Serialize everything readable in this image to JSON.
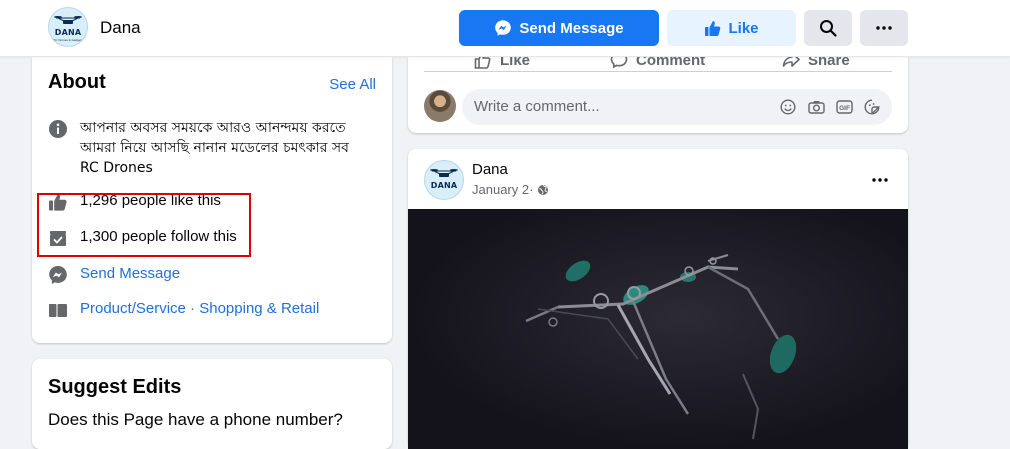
{
  "header": {
    "logo_text": "DANA",
    "logo_subtext": "RC Drones & Gadgets",
    "page_name": "Dana",
    "send_message_label": "Send Message",
    "like_label": "Like",
    "search_icon": "search-icon",
    "more_icon": "more-icon"
  },
  "about": {
    "title": "About",
    "see_all": "See All",
    "description": "আপনার অবসর সময়কে আরও আনন্দময় করতে আমরা নিয়ে আসছি নানান মডেলের চমৎকার সব RC Drones",
    "likes": "1,296 people like this",
    "follows": "1,300 people follow this",
    "send_message": "Send Message",
    "category_1": "Product/Service",
    "category_sep": " · ",
    "category_2": "Shopping & Retail"
  },
  "suggest": {
    "title": "Suggest Edits",
    "question": "Does this Page have a phone number?"
  },
  "post_actions": {
    "like": "Like",
    "comment": "Comment",
    "share": "Share",
    "comment_placeholder": "Write a comment..."
  },
  "post": {
    "author": "Dana",
    "date": "January 2",
    "separator": " · ",
    "logo_text": "DANA"
  },
  "colors": {
    "accent": "#1877f2",
    "link": "#216fdb",
    "highlight_border": "#e00000",
    "background": "#f0f2f5"
  }
}
